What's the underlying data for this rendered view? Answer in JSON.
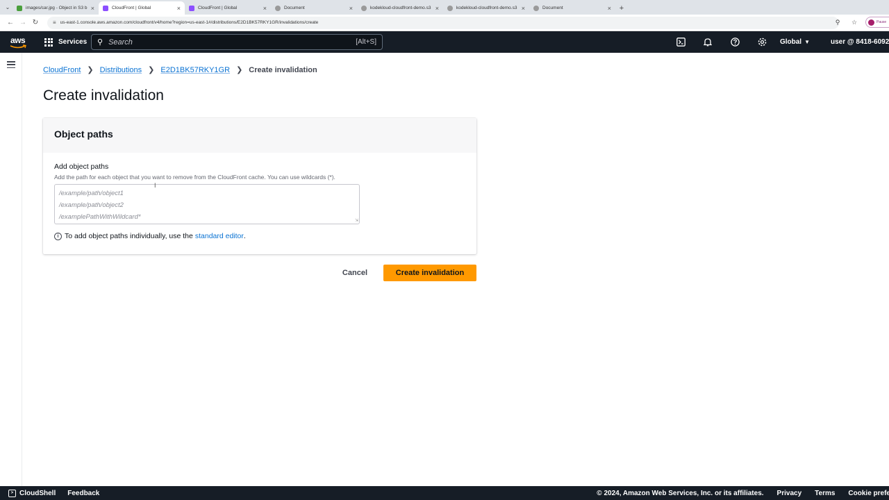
{
  "browser": {
    "tabs": [
      {
        "title": "images/car.jpg - Object in S3 b",
        "favicon_color": "#4a9f3c",
        "active": false
      },
      {
        "title": "CloudFront | Global",
        "favicon_color": "#8c4fff",
        "active": true
      },
      {
        "title": "CloudFront | Global",
        "favicon_color": "#8c4fff",
        "active": false
      },
      {
        "title": "Document",
        "favicon_color": "#777777",
        "active": false
      },
      {
        "title": "kodekloud-cloudfront-demo.s3",
        "favicon_color": "#777777",
        "active": false
      },
      {
        "title": "kodekloud-cloudfront-demo.s3",
        "favicon_color": "#777777",
        "active": false
      },
      {
        "title": "Document",
        "favicon_color": "#777777",
        "active": false
      }
    ],
    "url": "us-east-1.console.aws.amazon.com/cloudfront/v4/home?region=us-east-1#/distributions/E2D1BK57RKY1GR/invalidations/create",
    "profile_label": "Pause"
  },
  "awsnav": {
    "logo": "aws",
    "services_label": "Services",
    "search_placeholder": "Search",
    "search_shortcut": "[Alt+S]",
    "region": "Global",
    "user": "user @ 8418-6092-"
  },
  "breadcrumb": {
    "items": [
      "CloudFront",
      "Distributions",
      "E2D1BK57RKY1GR"
    ],
    "current": "Create invalidation"
  },
  "page": {
    "title": "Create invalidation"
  },
  "panel": {
    "header": "Object paths",
    "field_label": "Add object paths",
    "field_description": "Add the path for each object that you want to remove from the CloudFront cache. You can use wildcards (*).",
    "placeholder_lines": [
      "/example/path/object1",
      "/example/path/object2",
      "/examplePathWithWildcard*"
    ],
    "info_text": "To add object paths individually, use the",
    "info_link": "standard editor",
    "info_suffix": "."
  },
  "actions": {
    "cancel": "Cancel",
    "submit": "Create invalidation"
  },
  "footer": {
    "cloudshell": "CloudShell",
    "feedback": "Feedback",
    "copyright": "© 2024, Amazon Web Services, Inc. or its affiliates.",
    "privacy": "Privacy",
    "terms": "Terms",
    "cookie": "Cookie prefe"
  },
  "colors": {
    "nav_bg": "#161d26",
    "link": "#0972d3",
    "primary_button": "#ff9900"
  }
}
